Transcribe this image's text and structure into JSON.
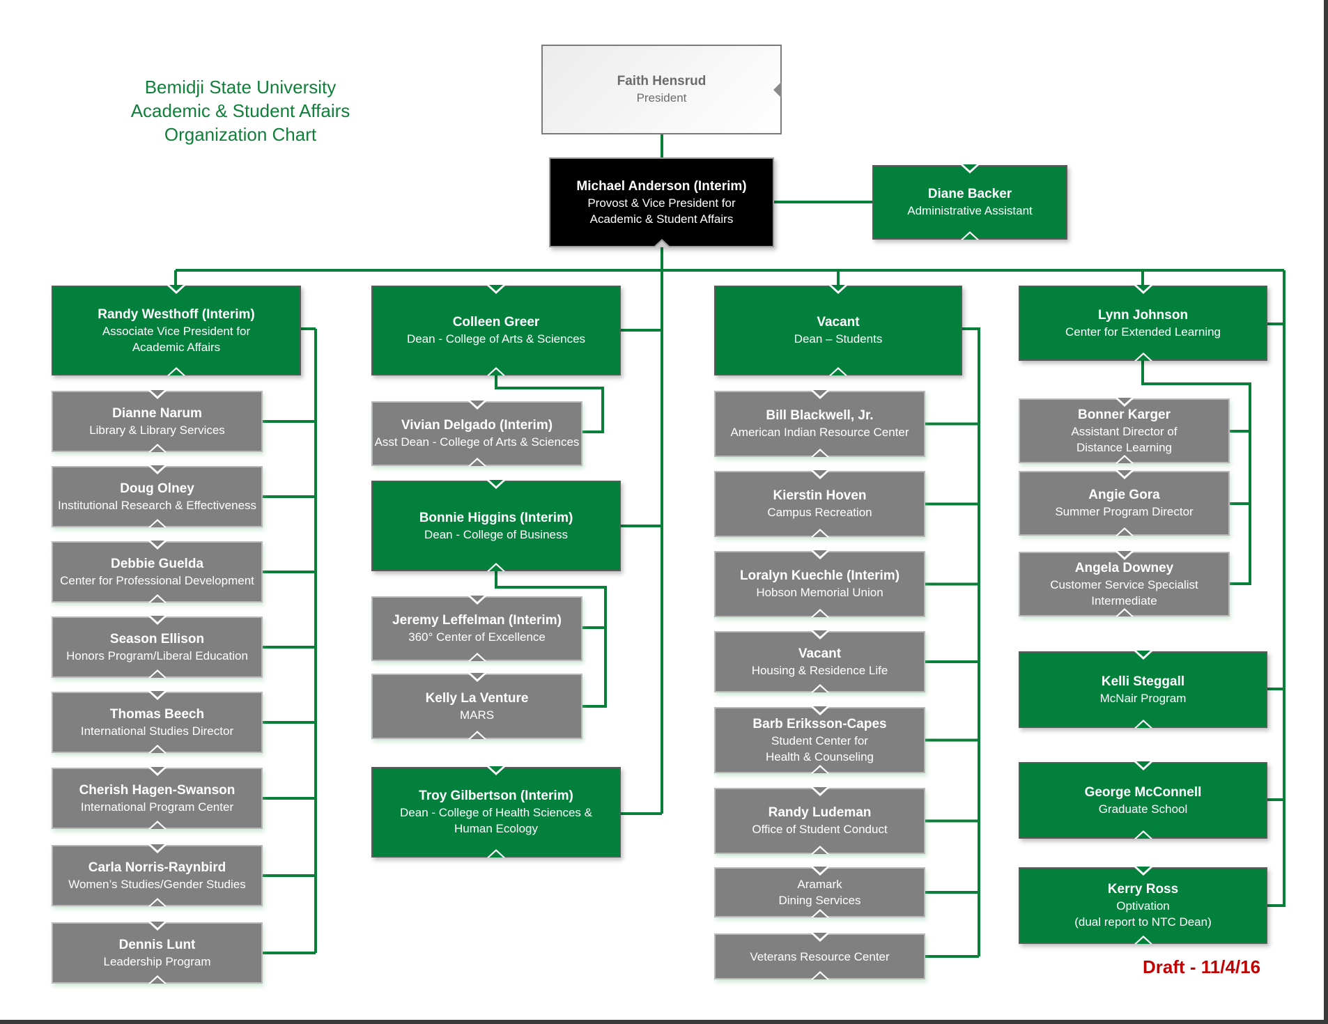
{
  "title": {
    "line1": "Bemidji State University",
    "line2": "Academic & Student Affairs",
    "line3": "Organization Chart"
  },
  "draft_label": "Draft - 11/4/16",
  "colors": {
    "green": "#03803c",
    "gray": "#808080",
    "black": "#000000",
    "title_green": "#0f7f3a",
    "draft_red": "#c00000",
    "connector": "#0a7f3a"
  },
  "president": {
    "name": "Faith Hensrud",
    "role": "President"
  },
  "provost": {
    "name": "Michael Anderson (Interim)",
    "role": "Provost & Vice President for\nAcademic & Student Affairs"
  },
  "assistant": {
    "name": "Diane Backer",
    "role": "Administrative Assistant"
  },
  "columns": [
    {
      "head": {
        "name": "Randy Westhoff (Interim)",
        "role": "Associate Vice President for\nAcademic Affairs"
      },
      "reports": [
        {
          "name": "Dianne Narum",
          "role": "Library & Library Services"
        },
        {
          "name": "Doug Olney",
          "role": "Institutional Research & Effectiveness"
        },
        {
          "name": "Debbie Guelda",
          "role": "Center for Professional Development"
        },
        {
          "name": "Season Ellison",
          "role": "Honors Program/Liberal Education"
        },
        {
          "name": "Thomas Beech",
          "role": "International Studies Director"
        },
        {
          "name": "Cherish Hagen-Swanson",
          "role": "International Program Center"
        },
        {
          "name": "Carla Norris-Raynbird",
          "role": "Women’s Studies/Gender Studies"
        },
        {
          "name": "Dennis Lunt",
          "role": "Leadership Program"
        }
      ]
    },
    {
      "deans": [
        {
          "name": "Colleen Greer",
          "role": "Dean - College of Arts & Sciences",
          "reports": [
            {
              "name": "Vivian Delgado (Interim)",
              "role": "Asst Dean - College of Arts & Sciences"
            }
          ]
        },
        {
          "name": "Bonnie Higgins (Interim)",
          "role": "Dean - College of Business",
          "reports": [
            {
              "name": "Jeremy Leffelman (Interim)",
              "role": "360° Center of Excellence"
            },
            {
              "name": "Kelly La Venture",
              "role": "MARS"
            }
          ]
        },
        {
          "name": "Troy Gilbertson (Interim)",
          "role": "Dean - College of Health Sciences &\nHuman Ecology",
          "reports": []
        }
      ]
    },
    {
      "head": {
        "name": "Vacant",
        "role": "Dean – Students"
      },
      "reports": [
        {
          "name": "Bill Blackwell, Jr.",
          "role": "American Indian Resource Center"
        },
        {
          "name": "Kierstin Hoven",
          "role": "Campus Recreation"
        },
        {
          "name": "Loralyn Kuechle (Interim)",
          "role": "Hobson Memorial Union"
        },
        {
          "name": "Vacant",
          "role": "Housing & Residence Life"
        },
        {
          "name": "Barb Eriksson-Capes",
          "role": "Student Center for\nHealth & Counseling"
        },
        {
          "name": "Randy Ludeman",
          "role": "Office of Student Conduct"
        },
        {
          "name": "",
          "role": "Aramark\nDining Services"
        },
        {
          "name": "",
          "role": "Veterans Resource Center"
        }
      ]
    },
    {
      "head": {
        "name": "Lynn Johnson",
        "role": "Center for Extended Learning"
      },
      "reports": [
        {
          "name": "Bonner Karger",
          "role": "Assistant Director of\nDistance Learning"
        },
        {
          "name": "Angie Gora",
          "role": "Summer Program Director"
        },
        {
          "name": "Angela Downey",
          "role": "Customer Service Specialist\nIntermediate"
        }
      ],
      "direct": [
        {
          "name": "Kelli Steggall",
          "role": "McNair Program"
        },
        {
          "name": "George McConnell",
          "role": "Graduate School"
        },
        {
          "name": "Kerry Ross",
          "role": "Optivation\n(dual report to NTC Dean)"
        }
      ]
    }
  ]
}
